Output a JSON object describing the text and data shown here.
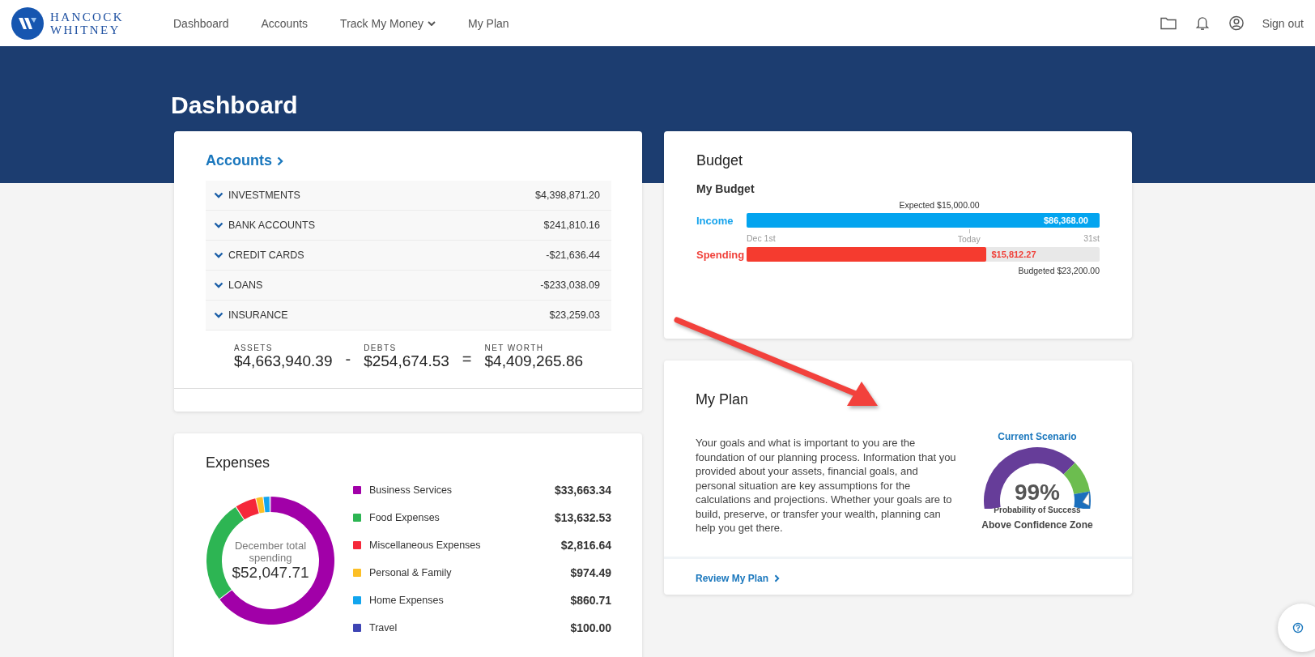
{
  "header": {
    "logo": {
      "line_1": "HANCOCK",
      "line_2": "WHITNEY"
    },
    "nav": [
      {
        "label": "Dashboard",
        "kind": "link"
      },
      {
        "label": "Accounts",
        "kind": "link"
      },
      {
        "label": "Track My Money",
        "kind": "dropdown"
      },
      {
        "label": "My Plan",
        "kind": "link"
      }
    ],
    "sign_out": "Sign out"
  },
  "page_title": "Dashboard",
  "accounts": {
    "title": "Accounts",
    "groups": [
      {
        "label": "INVESTMENTS",
        "amount": "$4,398,871.20"
      },
      {
        "label": "BANK ACCOUNTS",
        "amount": "$241,810.16"
      },
      {
        "label": "CREDIT CARDS",
        "amount": "-$21,636.44"
      },
      {
        "label": "LOANS",
        "amount": "-$233,038.09"
      },
      {
        "label": "INSURANCE",
        "amount": "$23,259.03"
      }
    ],
    "totals": [
      {
        "kind": "value",
        "label": "ASSETS",
        "amount": "$4,663,940.39"
      },
      {
        "kind": "operator",
        "symbol": "-"
      },
      {
        "kind": "value",
        "label": "DEBTS",
        "amount": "$254,674.53"
      },
      {
        "kind": "operator",
        "symbol": "="
      },
      {
        "kind": "value",
        "label": "NET WORTH",
        "amount": "$4,409,265.86"
      }
    ]
  },
  "expenses": {
    "title": "Expenses",
    "center": {
      "caption": "December total spending",
      "total": "$52,047.71"
    },
    "legend": [
      {
        "label": "Business Services",
        "amount": "$33,663.34",
        "color": "#a100a8"
      },
      {
        "label": "Food Expenses",
        "amount": "$13,632.53",
        "color": "#2db553"
      },
      {
        "label": "Miscellaneous Expenses",
        "amount": "$2,816.64",
        "color": "#f5283a"
      },
      {
        "label": "Personal & Family",
        "amount": "$974.49",
        "color": "#fcbf26"
      },
      {
        "label": "Home Expenses",
        "amount": "$860.71",
        "color": "#12a5ee"
      },
      {
        "label": "Travel",
        "amount": "$100.00",
        "color": "#3e45b4"
      }
    ],
    "chart_data": {
      "type": "donut",
      "values": [
        64.69,
        26.19,
        5.41,
        1.87,
        1.65,
        0.19
      ]
    }
  },
  "budget": {
    "title": "Budget",
    "subtitle": "My Budget",
    "expected": "Expected $15,000.00",
    "income": {
      "label": "Income",
      "amount": "$86,368.00"
    },
    "axis": {
      "start": "Dec 1st",
      "end": "31st"
    },
    "today": {
      "label": "Today",
      "level": 0.63
    },
    "spending": {
      "label": "Spending",
      "amount": "$15,812.27",
      "level": 0.68
    },
    "budgeted": "Budgeted $23,200.00"
  },
  "plan": {
    "title": "My Plan",
    "text": "Your goals and what is important to you are the foundation of our planning process. Information that you provided about your assets, financial goals, and personal situation are key assumptions for the calculations and projections. Whether your goals are to build, preserve, or transfer your wealth, planning can help you get there.",
    "gauge": {
      "title": "Current Scenario",
      "value": "99%",
      "caption": "Probability of Success",
      "zone": "Above Confidence Zone"
    },
    "link": "Review My Plan"
  }
}
